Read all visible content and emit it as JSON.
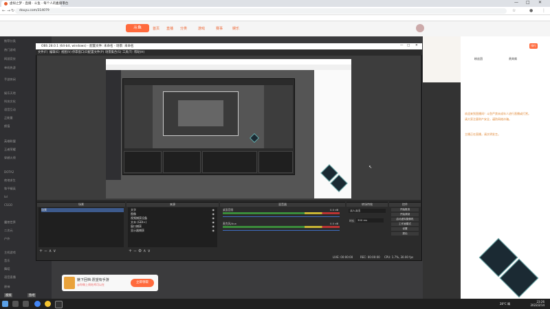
{
  "browser": {
    "tab_title": "虚拟之梦 - 直播 · 斗鱼 - 每个人的直播平台",
    "url": "douyu.com/314079",
    "new_tab": "+",
    "window_controls": [
      "—",
      "□",
      "✕"
    ]
  },
  "site": {
    "logo": "斗鱼",
    "nav": [
      "首页",
      "直播",
      "分类",
      "游戏",
      "赛事",
      "娱乐"
    ],
    "sidebar_items": [
      "推荐分类",
      "热门游戏",
      "网游竞技",
      "单机热游",
      "手游休闲",
      "娱乐天地",
      "科技文化",
      "语音互动",
      "正能量",
      "颜值",
      "英雄联盟",
      "王者荣耀",
      "穿越火线",
      "DOTA2",
      "绝地求生",
      "和平精英",
      "lol",
      "CSGO",
      "魔兽世界",
      "二次元",
      "户外",
      "主机游戏",
      "音乐",
      "舞蹈",
      "语音直播",
      "原神",
      "视频",
      "鱼吧"
    ],
    "chat_lines": [
      "欢迎来到直播间！斗鱼严禁未成年人进行直播或打赏。",
      "请大家注意财产安全，谨防网络诈骗。",
      "主播正在直播，请文明发言。"
    ],
    "gift_title": "魅下回档·愿望有手游",
    "gift_sub": "@你做上线吃鸡可以在",
    "gift_button": "立即领取",
    "right_badges": [
      "粉丝团",
      "贵宾席",
      "排行"
    ]
  },
  "obs": {
    "title": "OBS 28.0.1 (64-bit, windows) - 配置文件: 未命名 - 场景: 未命名",
    "menu": [
      "文件(F)",
      "编辑(E)",
      "视图(V)",
      "停靠窗口(D)",
      "配置文件(P)",
      "场景集合(S)",
      "工具(T)",
      "帮助(H)"
    ],
    "docks": {
      "scenes": "场景",
      "sources": "来源",
      "mixer": "混音器",
      "transitions": "转场特效",
      "controls": "控件"
    },
    "scene_items": [
      "场景"
    ],
    "source_items": [
      "文字",
      "图像",
      "视频捕获设备",
      "文本 (GDI+)",
      "窗口捕获",
      "显示器捕获"
    ],
    "mixer_tracks": [
      "桌面音频",
      "麦克风/Aux"
    ],
    "mixer_db": [
      "0.0 dB",
      "0.0 dB"
    ],
    "transition": "淡入淡出",
    "duration_label": "时长",
    "duration_value": "300 ms",
    "controls_buttons": [
      "开始推流",
      "开始录制",
      "启动虚拟摄像机",
      "工作室模式",
      "设置",
      "退出"
    ],
    "status": [
      "LIVE: 00:00:00",
      "REC: 00:00:00",
      "CPU: 1.7%, 30.00 fps"
    ]
  },
  "taskbar": {
    "weather": "28°C 晴",
    "time": "23:26",
    "date": "2022/2/14"
  }
}
